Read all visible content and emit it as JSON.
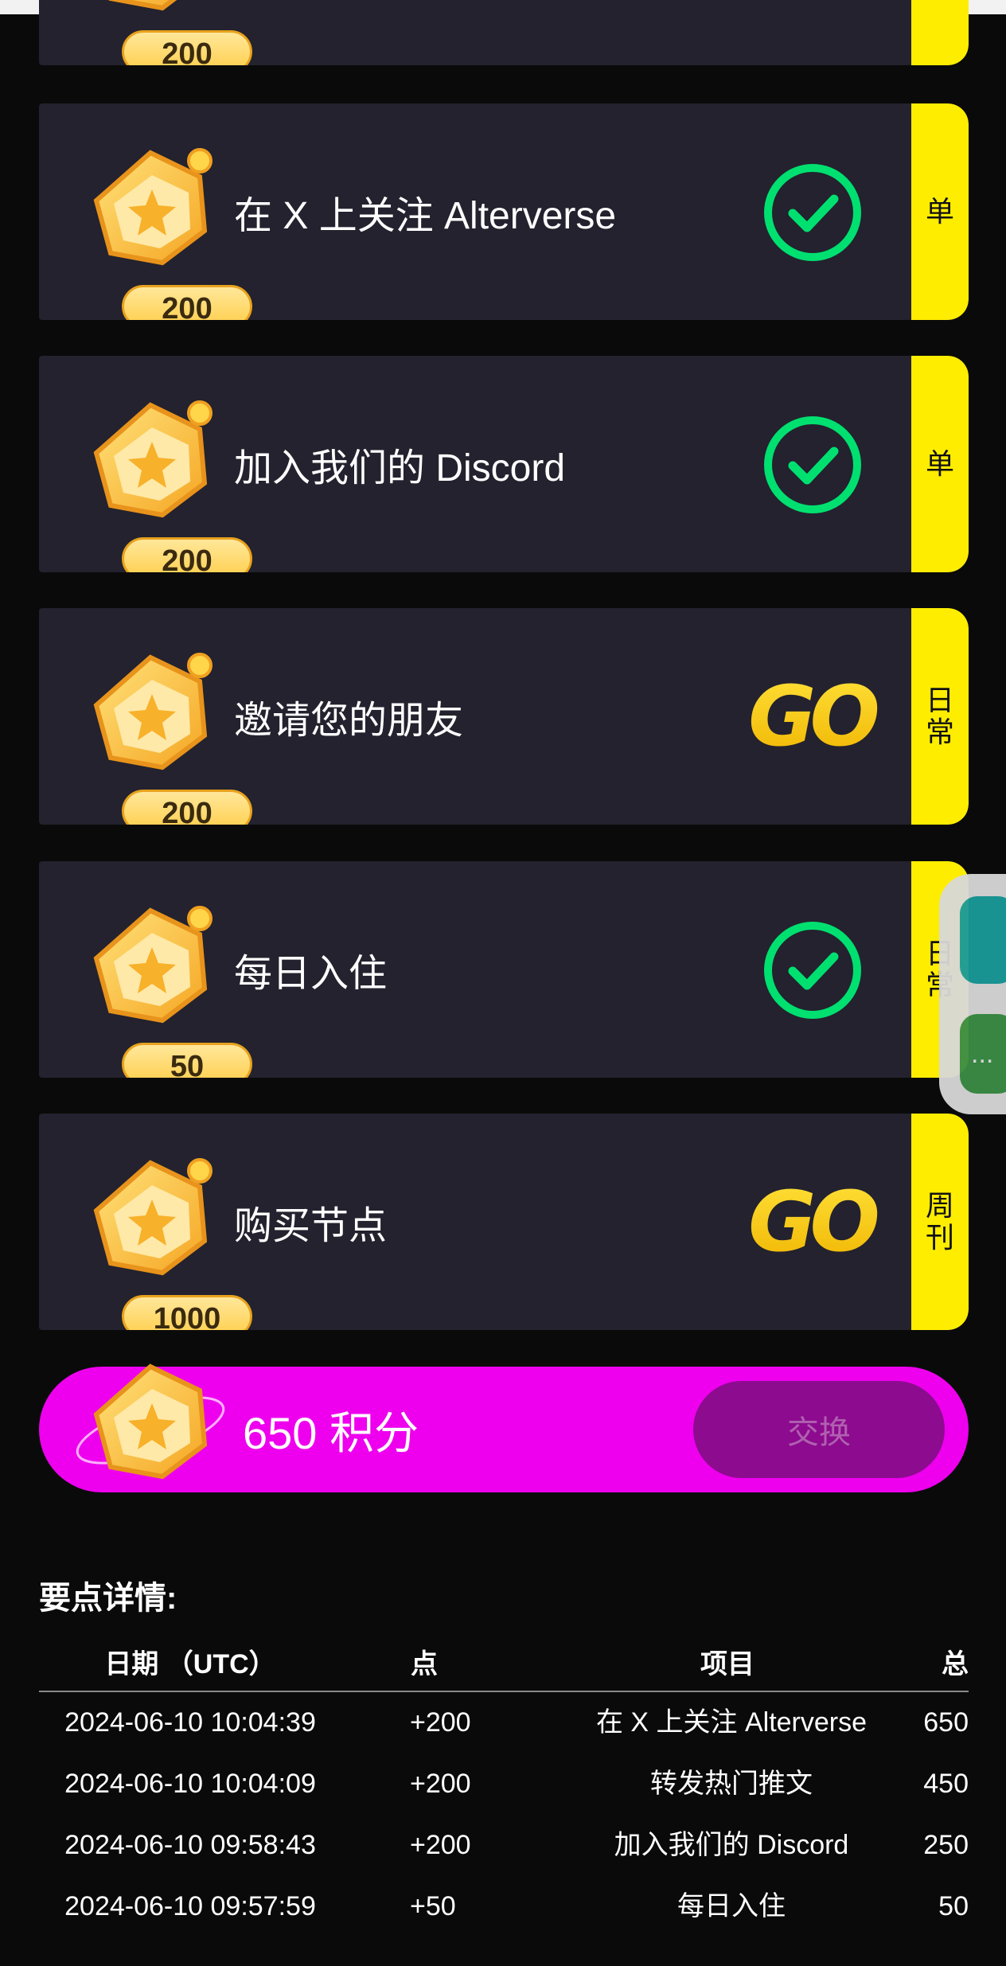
{
  "tasks": [
    {
      "reward": "200",
      "title": "",
      "tag": "",
      "status": "check"
    },
    {
      "reward": "200",
      "title": "在 X 上关注 Alterverse",
      "tag": "单",
      "status": "check"
    },
    {
      "reward": "200",
      "title": "加入我们的 Discord",
      "tag": "单",
      "status": "check"
    },
    {
      "reward": "200",
      "title": "邀请您的朋友",
      "tag": "日常",
      "status": "go"
    },
    {
      "reward": "50",
      "title": "每日入住",
      "tag": "日常",
      "status": "check"
    },
    {
      "reward": "1000",
      "title": "购买节点",
      "tag": "周刊",
      "status": "go"
    }
  ],
  "go_label": "GO",
  "points": {
    "label": "650 积分",
    "button": "交换"
  },
  "details": {
    "title": "要点详情:",
    "headers": {
      "date": "日期 （UTC）",
      "points": "点",
      "item": "项目",
      "total": "总"
    },
    "rows": [
      {
        "date": "2024-06-10 10:04:39",
        "points": "+200",
        "item": "在 X 上关注 Alterverse",
        "total": "650"
      },
      {
        "date": "2024-06-10 10:04:09",
        "points": "+200",
        "item": "转发热门推文",
        "total": "450"
      },
      {
        "date": "2024-06-10 09:58:43",
        "points": "+200",
        "item": "加入我们的 Discord",
        "total": "250"
      },
      {
        "date": "2024-06-10 09:57:59",
        "points": "+50",
        "item": "每日入住",
        "total": "50"
      }
    ]
  },
  "floating": {
    "more_label": "..."
  },
  "colors": {
    "accent_magenta": "#ee00ee",
    "tag_yellow": "#ffed00",
    "check_green": "#00e070",
    "card_bg": "#23222e"
  }
}
